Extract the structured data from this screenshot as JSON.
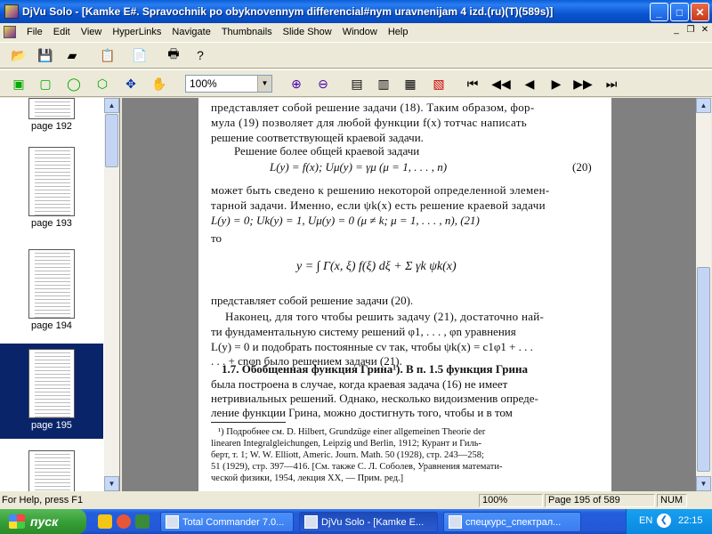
{
  "window": {
    "title": "DjVu Solo - [Kamke E#. Spravochnik po obyknovennym differencial#nym uravnenijam 4 izd.(ru)(T)(589s)]",
    "minimize": "_",
    "maximize": "□",
    "close": "✕"
  },
  "menu": [
    "File",
    "Edit",
    "View",
    "HyperLinks",
    "Navigate",
    "Thumbnails",
    "Slide Show",
    "Window",
    "Help"
  ],
  "toolbar": {
    "zoom_value": "100%"
  },
  "thumbnails": [
    {
      "label": "page 192",
      "selected": false
    },
    {
      "label": "page 193",
      "selected": false
    },
    {
      "label": "page 194",
      "selected": false
    },
    {
      "label": "page 195",
      "selected": true
    },
    {
      "label": "",
      "selected": false
    }
  ],
  "document": {
    "lines": [
      "представляет собой решение задачи (18). Таким образом, фор-",
      "мула (19) позволяет для любой функции f(x) тотчас написать",
      "решение соответствующей краевой задачи.",
      "Решение более общей краевой задачи",
      "L(y) = f(x);     Uμ(y) = γμ      (μ = 1, . . . , n)",
      "(20)",
      "может быть сведено к решению некоторой определенной элемен-",
      "тарной задачи. Именно, если ψk(x) есть решение краевой задачи",
      "L(y) = 0;   Uk(y) = 1,    Uμ(y) = 0      (μ ≠ k;  μ = 1, . . . , n),  (21)",
      "то",
      "y = ∫ Γ(x, ξ) f(ξ) dξ + Σ γk ψk(x)",
      "представляет собой решение задачи (20).",
      "Наконец, для того чтобы решить задачу (21), достаточно най-",
      "ти  фундаментальную  систему  решений  φ1, . . . , φn  уравнения",
      "L(y) = 0 и подобрать постоянные cν так, чтобы ψk(x) = c1φ1 + . . .",
      ". . . + cnφn было решением задачи (21).",
      "1.7. Обобщенная функция Грина¹). В п. 1.5 функция Грина",
      "была построена в случае, когда краевая задача (16) не имеет",
      "нетривиальных решений. Однако, несколько видоизменив опреде-",
      "ление функции Грина, можно достигнуть того, чтобы и в том"
    ],
    "footnote": [
      "¹) Подробнее см. D. Hilbert, Grundzüge einer allgemeinen Theorie der",
      "linearen Integralgleichungen, Leipzig und Berlin, 1912; Курант и Гиль-",
      "берт, т. 1; W. W. Elliott, Americ. Journ. Math. 50 (1928), стр. 243—258;",
      "51 (1929), стр. 397—416. [См. также С. Л. Соболев, Уравнения математи-",
      "ческой физики, 1954, лекция XX, — Прим. ред.]"
    ]
  },
  "status": {
    "help": "For Help, press F1",
    "zoom": "100%",
    "page": "Page 195 of 589",
    "num": "NUM"
  },
  "taskbar": {
    "start": "пуск",
    "tasks": [
      {
        "label": "Total Commander 7.0...",
        "active": false
      },
      {
        "label": "DjVu Solo - [Kamke E...",
        "active": true
      },
      {
        "label": "спецкурс_спектрал...",
        "active": false
      }
    ],
    "lang": "EN",
    "clock": "22:15"
  }
}
